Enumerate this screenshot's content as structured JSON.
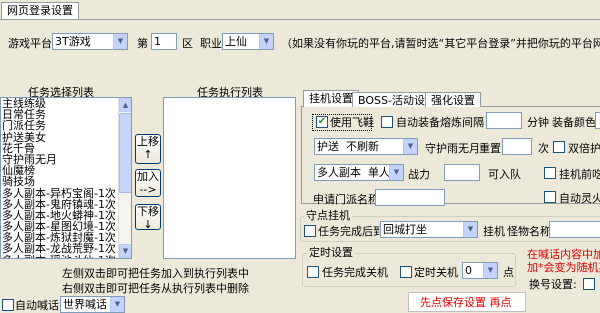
{
  "main_tab": {
    "label": "网页登录设置"
  },
  "login": {
    "platform_label": "游戏平台",
    "platform_value": "3T游戏",
    "server_prefix": "第",
    "server_value": "1",
    "server_suffix": "区",
    "class_label": "职业",
    "class_value": "上仙",
    "hint": "（如果没有你玩的平台,请暂时选“其它平台登录”并把你玩的平台网址发"
  },
  "task_list": {
    "title": "任务选择列表",
    "items": [
      "主线练级",
      "日常任务",
      "门派任务",
      "护送美女",
      "花千骨",
      "守护雨无月",
      "仙魔榜",
      "骑技场",
      "多人副本-异朽宝阁-1次",
      "多人副本-鬼府镇魂-1次",
      "多人副本-地火蟒神-1次",
      "多人副本-星图幻境-1次",
      "多人副本-炼狱封魔-1次",
      "多人副本-龙战荒野-1次",
      "多人副本-瑶池斗仙-1次"
    ]
  },
  "exec_list": {
    "title": "任务执行列表",
    "items": []
  },
  "move_buttons": {
    "up": "上移\n↑",
    "add": "加入\n-->",
    "down": "下移\n↓"
  },
  "list_hints": {
    "line1": "左侧双击即可把任务加入到执行列表中",
    "line2": "右侧双击即可把任务从执行列表中删除"
  },
  "shout": {
    "checkbox_label": "自动喊话",
    "checked": false,
    "channel": "世界喊话"
  },
  "inner_tabs": [
    "挂机设置",
    "BOSS-活动设置",
    "强化设置"
  ],
  "hangup": {
    "use_flying_shoes": "使用飞鞋",
    "use_flying_shoes_checked": true,
    "auto_smelt": "自动装备熔炼",
    "interval_label": "间隔",
    "interval_value": "",
    "minute_label": "分钟",
    "equip_color_label": "装备颜色",
    "escort_value": "护送",
    "escort_refresh": "不刷新",
    "guard_label": "守护雨无月",
    "reset_label": "重置",
    "reset_value": "",
    "times_label": "次",
    "double_escort": "双倍护送",
    "dungeon_mode": "多人副本",
    "dungeon_type": "单人刷",
    "power_label": "战力",
    "power_value": "",
    "can_join": "可入队",
    "hang_before_act": "挂机前吃双",
    "apply_sect_label": "申请门派名称",
    "apply_sect_value": "",
    "auto_spirit": "自动灵火"
  },
  "hang_spot": {
    "title": "守点挂机",
    "after_done_checkbox": "任务完成后到",
    "destination": "回城打坐",
    "monster_prefix": "挂机",
    "monster_label": "怪物名称"
  },
  "timer": {
    "title": "定时设置",
    "shutdown_done": "任务完成关机",
    "timed_shutdown": "定时关机",
    "hour_value": "0",
    "hour_unit": "点"
  },
  "notice": {
    "line1": "在喊话内容中加",
    "line2": "加*会变为随机英"
  },
  "switch_label": "换号设置:",
  "save_hint": "先点保存设置  再点",
  "colors": {
    "accent": "#e00000",
    "border": "#7f9db9"
  }
}
